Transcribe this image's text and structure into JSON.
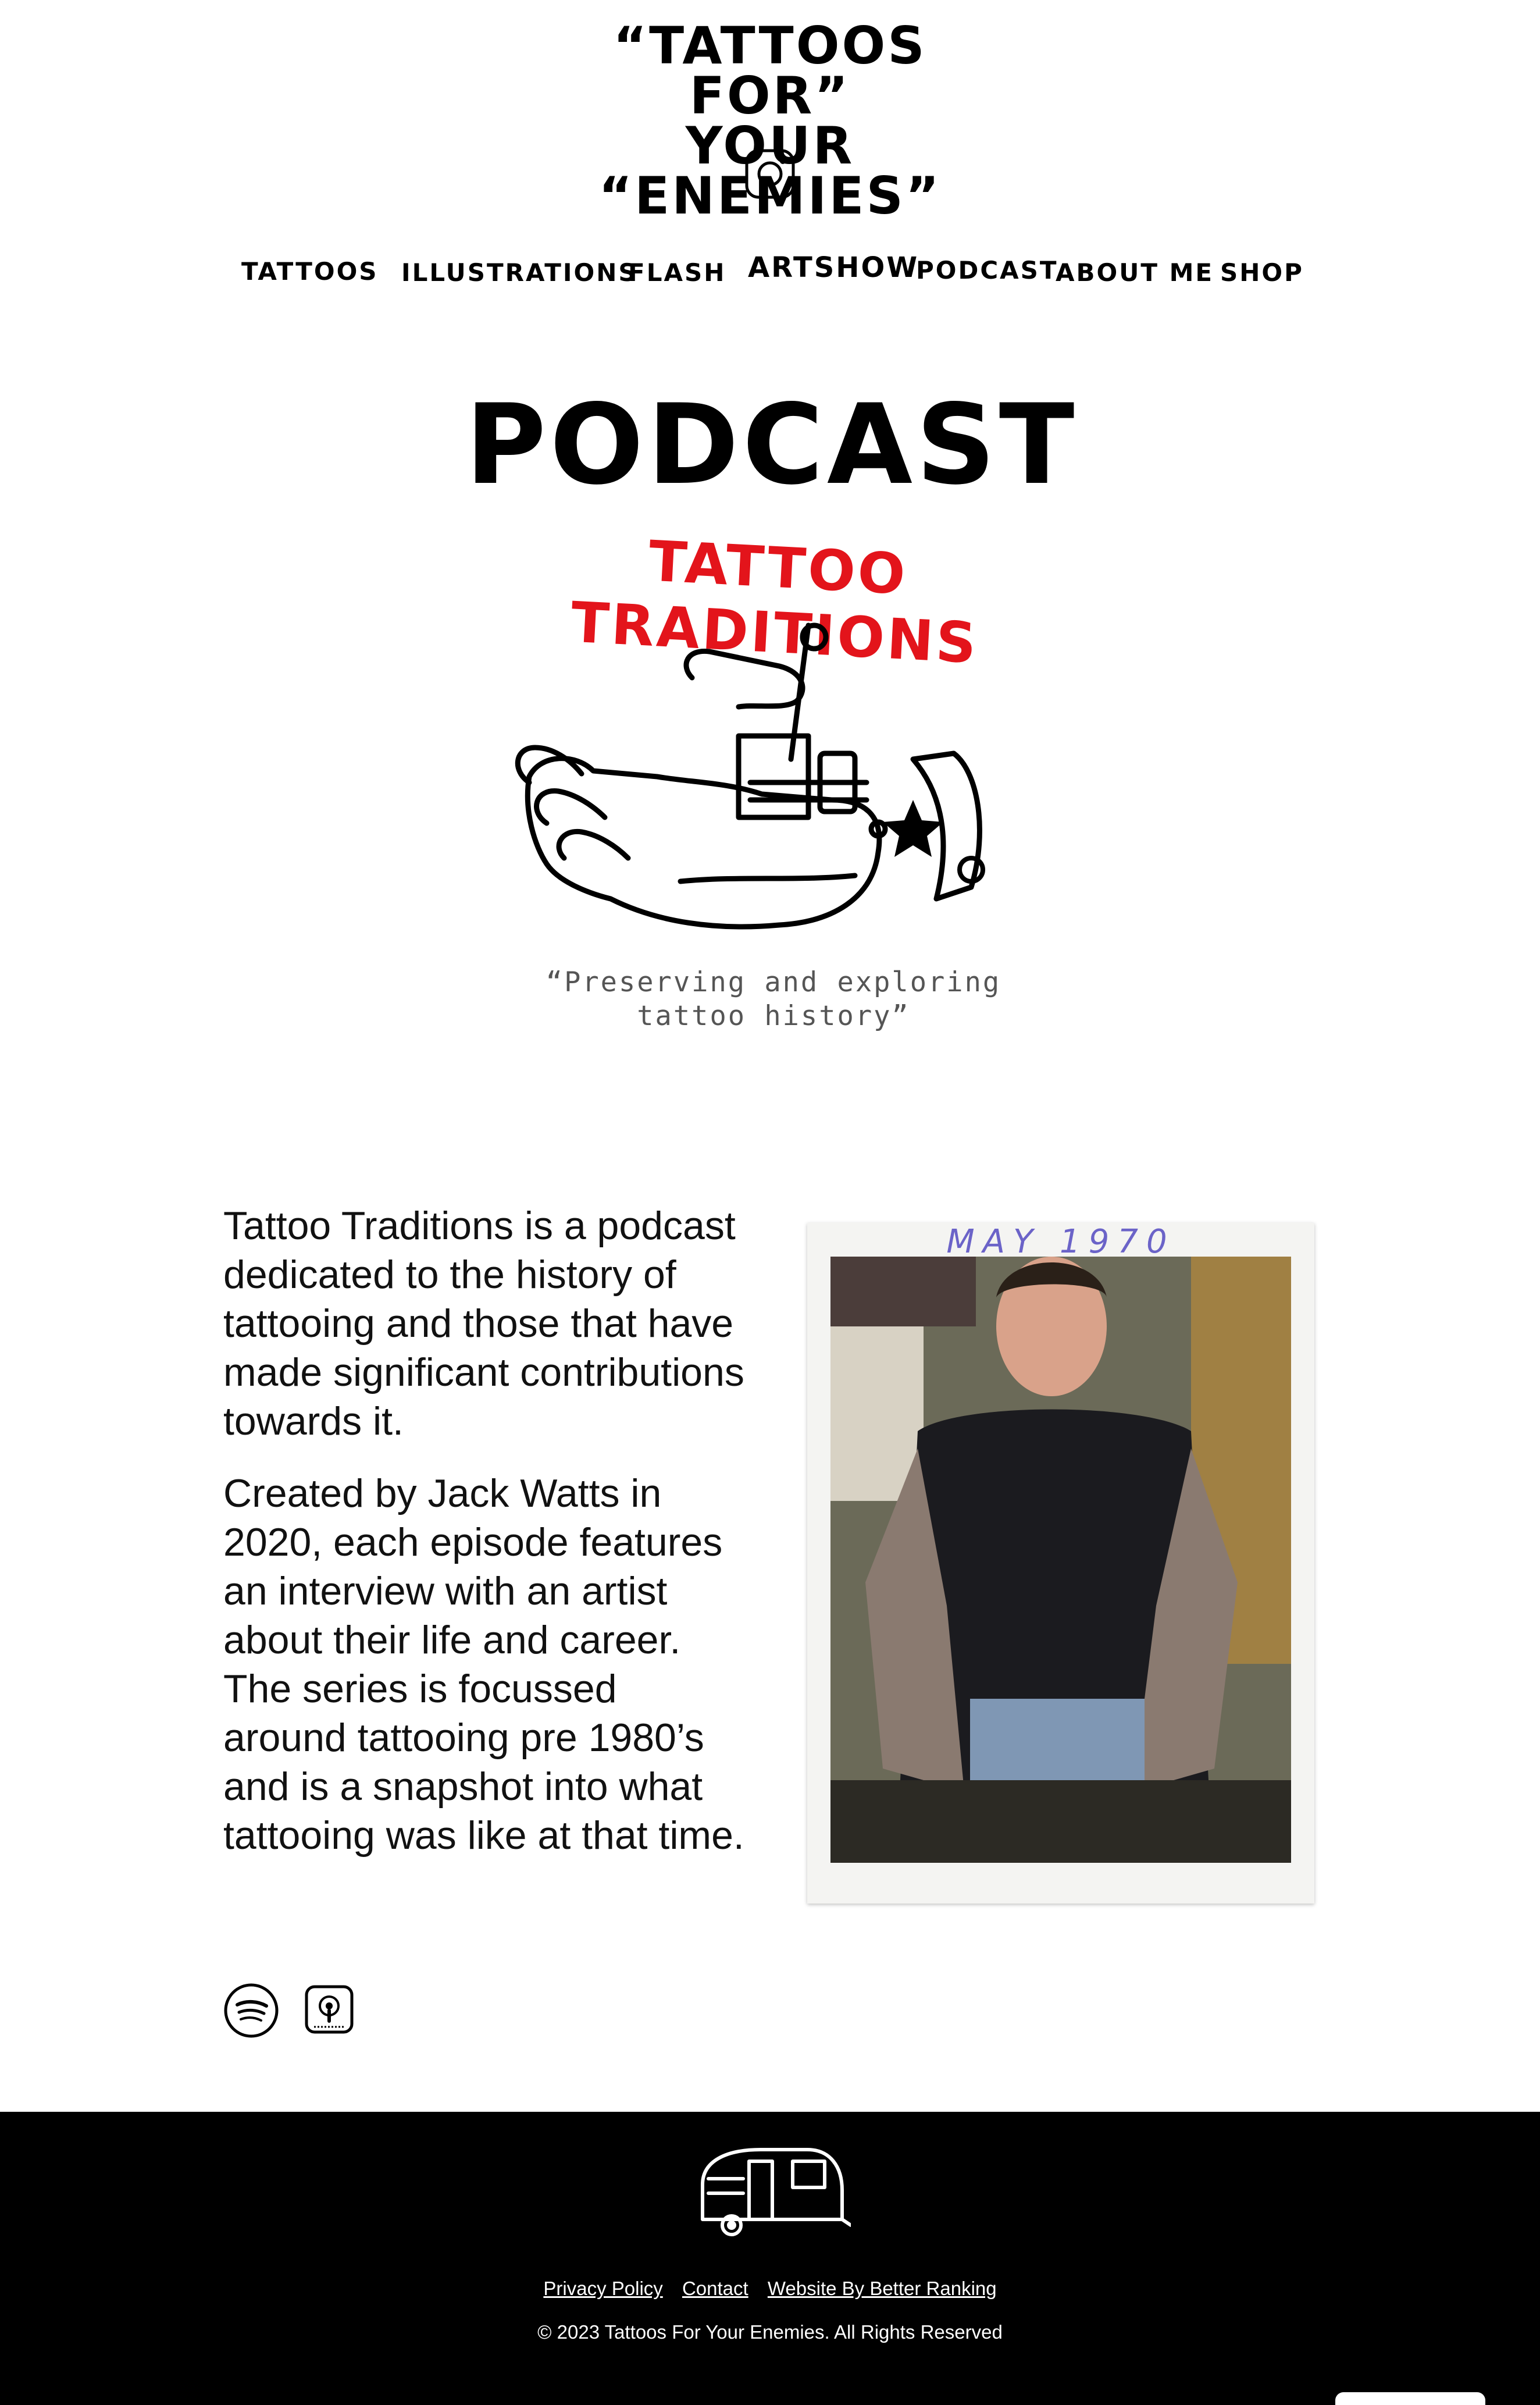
{
  "header": {
    "logo_line1": "“TATTOOS FOR”",
    "logo_line2": "YOUR “ENEMIES”",
    "instagram_icon": "instagram-icon"
  },
  "nav": {
    "items": [
      {
        "label": "TATTOOS"
      },
      {
        "label": "ILLUSTRATIONS"
      },
      {
        "label": "FLASH"
      },
      {
        "label": "ARTSHOW"
      },
      {
        "label": "PODCAST"
      },
      {
        "label": "ABOUT ME"
      },
      {
        "label": "SHOP"
      }
    ]
  },
  "hero": {
    "title": "PODCAST",
    "podcast_name": "TATTOO TRADITIONS",
    "tagline": "“Preserving and exploring tattoo history”"
  },
  "intro": {
    "paragraph1": "Tattoo Traditions is a podcast dedicated to the history of tattooing and those that have made significant contributions towards it.",
    "paragraph2": "Created by Jack Watts in 2020, each episode features an interview with an artist about their life and career. The series is focussed around tattooing pre 1980’s and is a snapshot into what tattooing was like at that time."
  },
  "platforms": {
    "items": [
      {
        "icon": "spotify-icon"
      },
      {
        "icon": "apple-podcasts-icon"
      }
    ]
  },
  "polaroid": {
    "caption": "MAY 1970"
  },
  "footer": {
    "links": [
      {
        "label": "Privacy Policy"
      },
      {
        "label": "Contact"
      },
      {
        "label": "Website By Better Ranking"
      }
    ],
    "copyright": "© 2023 Tattoos For Your Enemies. All Rights Reserved"
  },
  "colors": {
    "accent_red": "#e3141b",
    "footer_bg": "#000000",
    "tagline_gray": "#555555",
    "caption_purple": "#6b63c8"
  }
}
